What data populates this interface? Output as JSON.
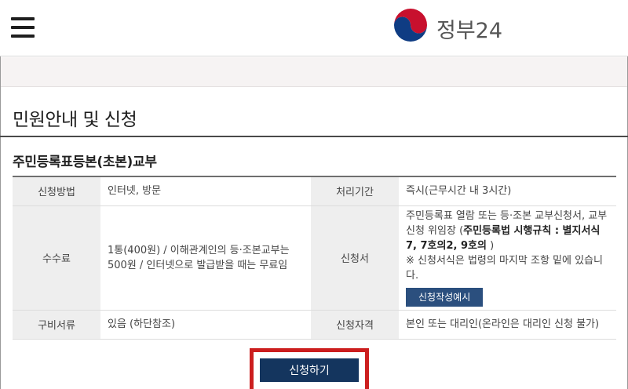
{
  "header": {
    "logo_text": "정부24"
  },
  "page": {
    "title": "민원안내 및 신청",
    "section_title": "주민등록표등본(초본)교부"
  },
  "table": {
    "rows": [
      {
        "label1": "신청방법",
        "value1": "인터넷, 방문",
        "label2": "처리기간",
        "value2": "즉시(근무시간 내 3시간)"
      },
      {
        "label1": "수수료",
        "value1": "1통(400원) / 이해관계인의 등·조본교부는 500원 / 인터넷으로 발급받을 때는 무료임",
        "label2": "신청서",
        "value2_plain": "주민등록표 열람 또는 등·조본 교부신청서, 교부신청 위임장 (",
        "value2_bold": "주민등록법 시행규칙 : 별지서식 7, 7호의2, 9호의",
        "value2_close": " )",
        "value2_note": "※ 신청서식은 법령의 마지막 조항 밑에 있습니다.",
        "example_button": "신청작성예시"
      },
      {
        "label1": "구비서류",
        "value1": "있음 (하단참조)",
        "label2": "신청자격",
        "value2": "본인 또는 대리인(온라인은 대리인 신청 불가)"
      }
    ]
  },
  "actions": {
    "apply_button": "신청하기"
  },
  "colors": {
    "apply_button_bg": "#14355e",
    "highlight_border": "#cc1e1e",
    "example_button_bg": "#2b4f7e"
  }
}
